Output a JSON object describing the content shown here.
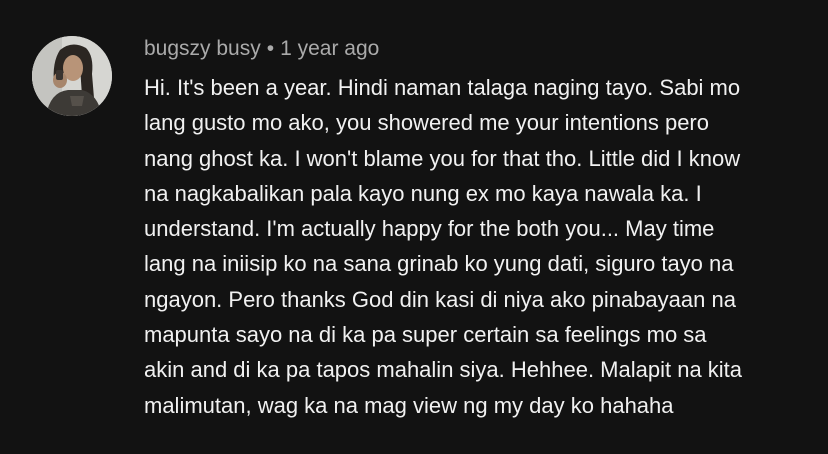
{
  "comment": {
    "author": "bugszy busy",
    "separator": "•",
    "timestamp": "1 year ago",
    "lines": [
      "Hi. It's been a year. Hindi naman talaga naging tayo. Sabi mo",
      "lang gusto mo ako, you showered me your intentions pero",
      "nang ghost ka. I won't blame you for that tho. Little did I know",
      "na nagkabalikan pala kayo nung ex mo kaya nawala ka. I",
      "understand. I'm actually happy for the both you... May time",
      "lang na iniisip ko na sana grinab ko yung dati, siguro tayo na",
      "ngayon. Pero thanks God din kasi di niya ako pinabayaan na",
      "mapunta sayo na di ka pa super certain sa feelings mo sa",
      "akin and di ka pa tapos mahalin siya. Hehhee. Malapit na kita",
      "malimutan, wag ka na mag view ng my day ko hahaha"
    ]
  },
  "colors": {
    "background": "#121212",
    "text_primary": "#f1f1f1",
    "text_secondary": "#aaaaaa"
  }
}
